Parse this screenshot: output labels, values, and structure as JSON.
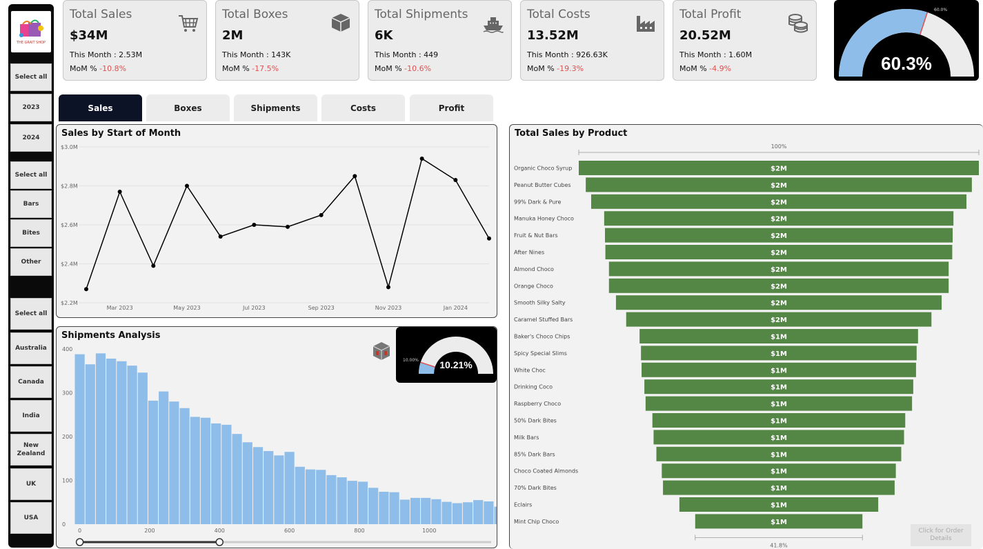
{
  "brand": {
    "name": "THE GRAIT SHOP"
  },
  "slicers": {
    "year": [
      "Select all",
      "2023",
      "2024"
    ],
    "category": [
      "Select all",
      "Bars",
      "Bites",
      "Other"
    ],
    "country": [
      "Select all",
      "Australia",
      "Canada",
      "India",
      "New Zealand",
      "UK",
      "USA"
    ]
  },
  "kpis": [
    {
      "title": "Total Sales",
      "value": "$34M",
      "month_label": "This Month : 2.53M",
      "mom_label": "MoM % ",
      "mom_value": "-10.8%",
      "icon": "cart-icon"
    },
    {
      "title": "Total Boxes",
      "value": "2M",
      "month_label": "This Month : 143K",
      "mom_label": "MoM % ",
      "mom_value": "-17.5%",
      "icon": "box-icon"
    },
    {
      "title": "Total Shipments",
      "value": "6K",
      "month_label": "This Month : 449",
      "mom_label": "MoM % ",
      "mom_value": "-10.6%",
      "icon": "ship-icon"
    },
    {
      "title": "Total Costs",
      "value": "13.52M",
      "month_label": "This Month : 926.63K",
      "mom_label": "MoM % ",
      "mom_value": "-19.3%",
      "icon": "factory-icon"
    },
    {
      "title": "Total Profit",
      "value": "20.52M",
      "month_label": "This Month : 1.60M",
      "mom_label": "MoM % ",
      "mom_value": "-4.9%",
      "icon": "coins-icon"
    }
  ],
  "profit_gauge": {
    "value_label": "60.3%",
    "value": 60.3,
    "target_label": "60.0%",
    "target": 60.0
  },
  "tabs": [
    "Sales",
    "Boxes",
    "Shipments",
    "Costs",
    "Profit"
  ],
  "active_tab": "Sales",
  "sales_chart": {
    "title": "Sales by Start of Month"
  },
  "shipments_chart": {
    "title": "Shipments Analysis"
  },
  "shipments_gauge": {
    "value_label": "10.21%",
    "value": 10.21,
    "target_label": "10.00%",
    "target": 10.0
  },
  "product_chart": {
    "title": "Total Sales by Product",
    "top_label": "100%",
    "bottom_label": "41.8%"
  },
  "order_button": {
    "label": "Click for Order Details"
  },
  "colors": {
    "accent_dark": "#0c1326",
    "bar_green": "#548745",
    "bar_blue": "#8dbde8",
    "negative": "#e05050"
  },
  "chart_data": [
    {
      "type": "line",
      "title": "Sales by Start of Month",
      "x": [
        "Feb 2023",
        "Mar 2023",
        "Apr 2023",
        "May 2023",
        "Jun 2023",
        "Jul 2023",
        "Aug 2023",
        "Sep 2023",
        "Oct 2023",
        "Nov 2023",
        "Dec 2023",
        "Jan 2024",
        "Feb 2024"
      ],
      "x_tick_labels": [
        "Mar 2023",
        "May 2023",
        "Jul 2023",
        "Sep 2023",
        "Nov 2023",
        "Jan 2024"
      ],
      "values": [
        2.27,
        2.77,
        2.39,
        2.8,
        2.54,
        2.6,
        2.59,
        2.65,
        2.85,
        2.28,
        2.94,
        2.83,
        2.53
      ],
      "ylim": [
        2.2,
        3.0
      ],
      "y_tick_labels": [
        "$2.2M",
        "$2.4M",
        "$2.6M",
        "$2.8M",
        "$3.0M"
      ],
      "y_ticks": [
        2.2,
        2.4,
        2.6,
        2.8,
        3.0
      ],
      "grid": true
    },
    {
      "type": "bar",
      "title": "Shipments Analysis",
      "bin_width": 30,
      "x_start": -15,
      "values": [
        388,
        365,
        390,
        378,
        372,
        362,
        346,
        282,
        303,
        280,
        265,
        245,
        243,
        230,
        227,
        206,
        187,
        176,
        167,
        157,
        165,
        131,
        125,
        124,
        112,
        107,
        99,
        97,
        83,
        74,
        73,
        56,
        60,
        60,
        57,
        51,
        48,
        50,
        55,
        52,
        40,
        49,
        42,
        45,
        34,
        34,
        39,
        38,
        37,
        33,
        34,
        31,
        33,
        29,
        30,
        26,
        25,
        24,
        25,
        20,
        24,
        28,
        34,
        30,
        26
      ],
      "xlim": [
        -15,
        1185
      ],
      "ylim": [
        0,
        400
      ],
      "x_tick_labels": [
        "0",
        "200",
        "400",
        "600",
        "800",
        "1000"
      ],
      "x_ticks": [
        0,
        200,
        400,
        600,
        800,
        1000
      ],
      "y_tick_labels": [
        "0",
        "100",
        "200",
        "300",
        "400"
      ],
      "y_ticks": [
        0,
        100,
        200,
        300,
        400
      ],
      "range_slider": [
        0,
        400
      ]
    },
    {
      "type": "bar",
      "orientation": "funnel",
      "title": "Total Sales by Product",
      "categories": [
        "Organic Choco Syrup",
        "Peanut Butter Cubes",
        "99% Dark & Pure",
        "Manuka Honey Choco",
        "Fruit & Nut Bars",
        "After Nines",
        "Almond Choco",
        "Orange Choco",
        "Smooth Silky Salty",
        "Caramel Stuffed Bars",
        "Baker's Choco Chips",
        "Spicy Special Slims",
        "White Choc",
        "Drinking Coco",
        "Raspberry Choco",
        "50% Dark Bites",
        "Milk Bars",
        "85% Dark Bars",
        "Choco Coated Almonds",
        "70% Dark Bites",
        "Eclairs",
        "Mint Chip Choco"
      ],
      "values": [
        100,
        96.5,
        93.8,
        87.3,
        86.9,
        86.7,
        84.9,
        84.9,
        81.4,
        76.3,
        69.6,
        68.9,
        68.6,
        67.2,
        66.6,
        63.2,
        62.6,
        61.2,
        58.5,
        57.9,
        49.7,
        41.8
      ],
      "data_labels": [
        "$2M",
        "$2M",
        "$2M",
        "$2M",
        "$2M",
        "$2M",
        "$2M",
        "$2M",
        "$2M",
        "$2M",
        "$1M",
        "$1M",
        "$1M",
        "$1M",
        "$1M",
        "$1M",
        "$1M",
        "$1M",
        "$1M",
        "$1M",
        "$1M",
        "$1M"
      ],
      "unit": "%"
    }
  ]
}
